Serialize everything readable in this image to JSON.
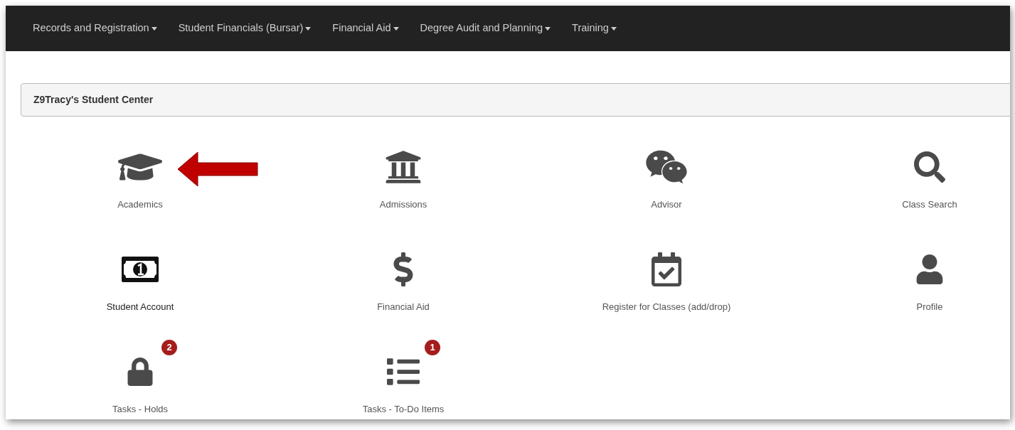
{
  "nav": {
    "items": [
      {
        "label": "Records and Registration"
      },
      {
        "label": "Student Financials (Bursar)"
      },
      {
        "label": "Financial Aid"
      },
      {
        "label": "Degree Audit and Planning"
      },
      {
        "label": "Training"
      }
    ]
  },
  "panel": {
    "title": "Z9Tracy's Student Center"
  },
  "tiles": [
    {
      "label": "Academics"
    },
    {
      "label": "Admissions"
    },
    {
      "label": "Advisor"
    },
    {
      "label": "Class Search"
    },
    {
      "label": "Student Account"
    },
    {
      "label": "Financial Aid"
    },
    {
      "label": "Register for Classes (add/drop)"
    },
    {
      "label": "Profile"
    },
    {
      "label": "Tasks - Holds",
      "badge": "2"
    },
    {
      "label": "Tasks - To-Do Items",
      "badge": "1"
    }
  ]
}
